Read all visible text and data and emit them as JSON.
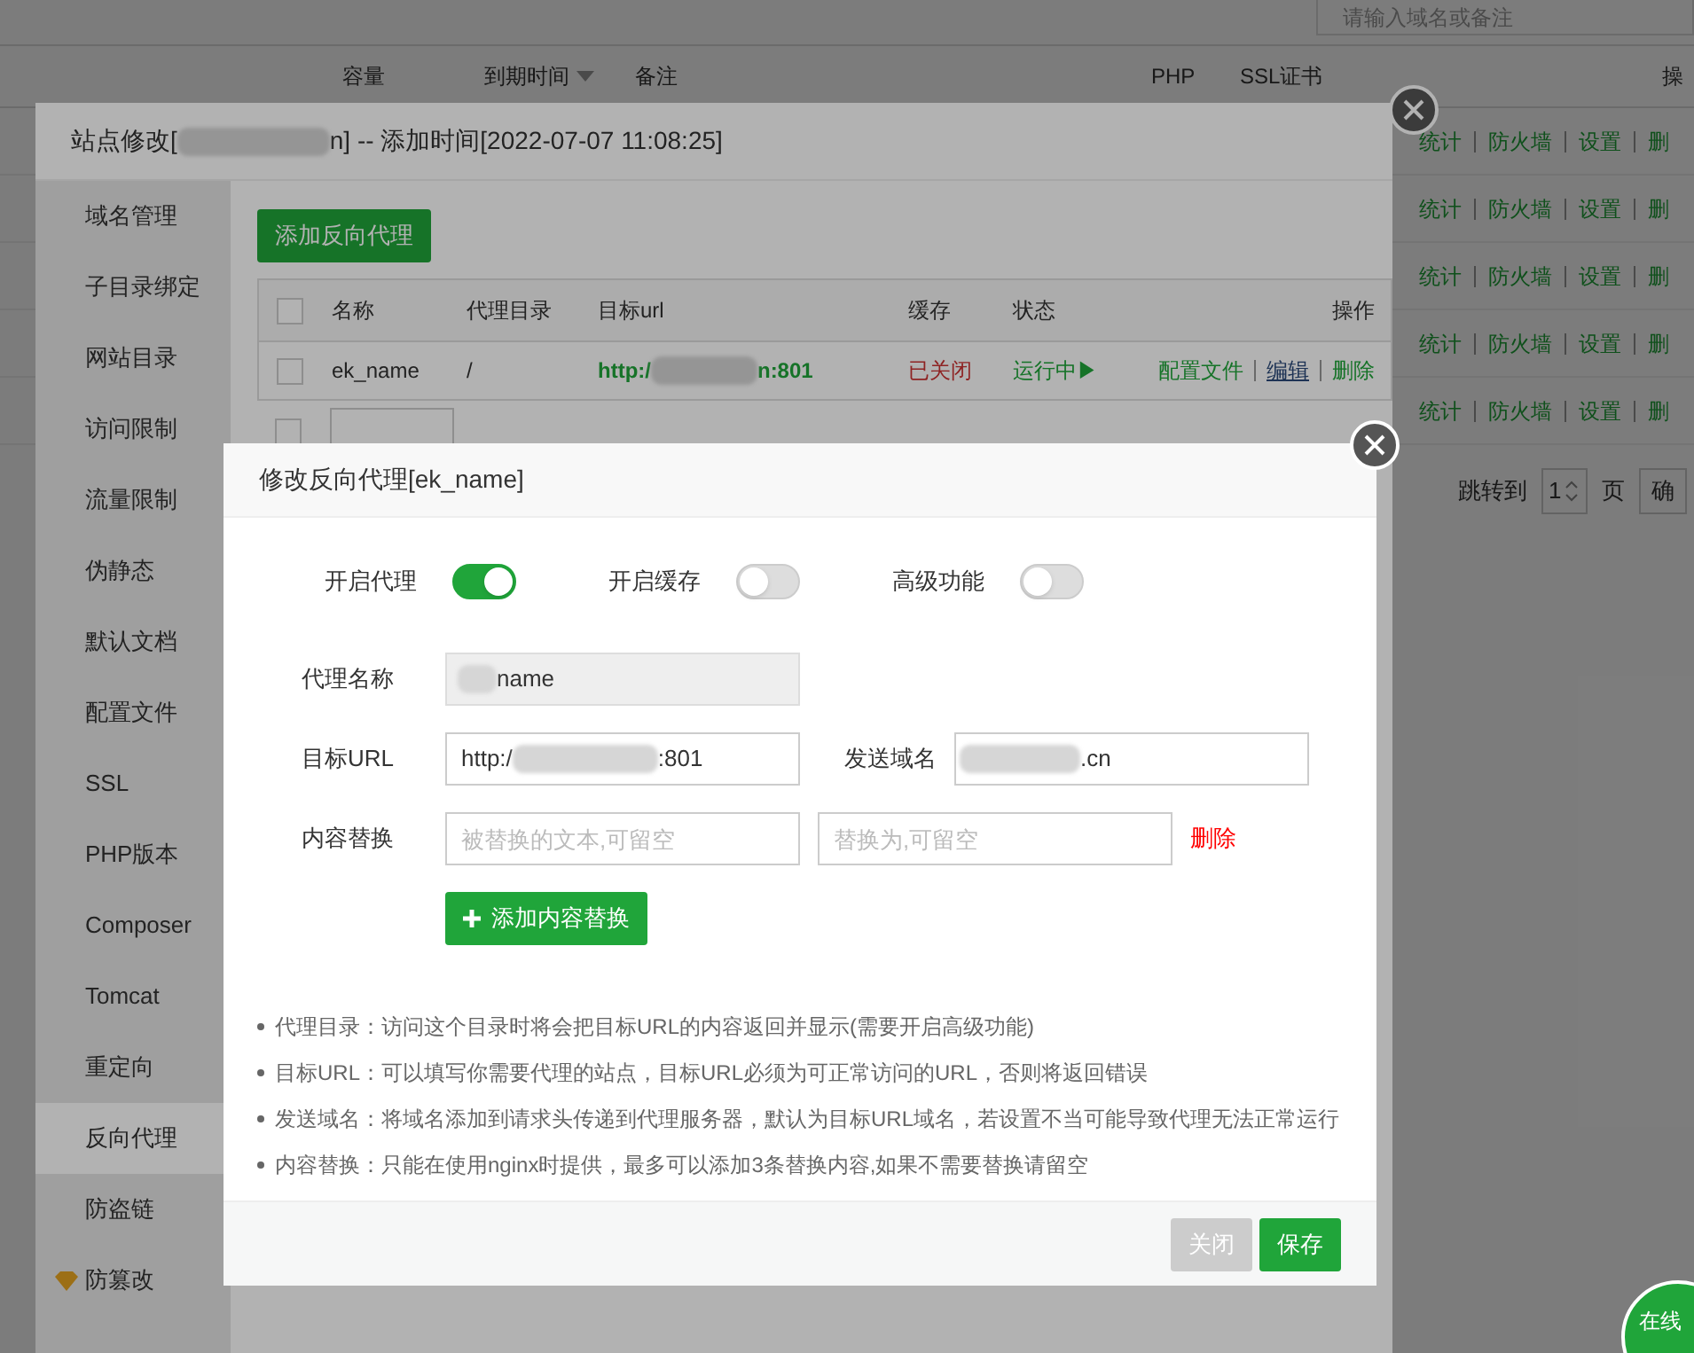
{
  "page": {
    "search": {
      "placeholder": "请输入域名或备注"
    },
    "columns": [
      "容量",
      "到期时间",
      "备注",
      "PHP",
      "SSL证书",
      "操"
    ],
    "rows": [
      {
        "actions": [
          "统计",
          "防火墙",
          "设置",
          "删"
        ]
      },
      {
        "actions": [
          "统计",
          "防火墙",
          "设置",
          "删"
        ]
      },
      {
        "actions": [
          "统计",
          "防火墙",
          "设置",
          "删"
        ]
      },
      {
        "actions": [
          "统计",
          "防火墙",
          "设置",
          "删"
        ]
      },
      {
        "actions": [
          "统计",
          "防火墙",
          "设置",
          "删"
        ]
      }
    ],
    "pagination": {
      "jump_label": "跳转到",
      "page": "1",
      "page_unit": "页",
      "confirm": "确"
    }
  },
  "site_dialog": {
    "title_start": "站点修改[",
    "title_end": "n] -- 添加时间[2022-07-07 11:08:25]",
    "sidebar": [
      {
        "label": "域名管理",
        "selected": false
      },
      {
        "label": "子目录绑定",
        "selected": false
      },
      {
        "label": "网站目录",
        "selected": false
      },
      {
        "label": "访问限制",
        "selected": false
      },
      {
        "label": "流量限制",
        "selected": false
      },
      {
        "label": "伪静态",
        "selected": false
      },
      {
        "label": "默认文档",
        "selected": false
      },
      {
        "label": "配置文件",
        "selected": false
      },
      {
        "label": "SSL",
        "selected": false
      },
      {
        "label": "PHP版本",
        "selected": false
      },
      {
        "label": "Composer",
        "selected": false
      },
      {
        "label": "Tomcat",
        "selected": false
      },
      {
        "label": "重定向",
        "selected": false
      },
      {
        "label": "反向代理",
        "selected": true
      },
      {
        "label": "防盗链",
        "selected": false
      },
      {
        "label": "防篡改",
        "selected": false,
        "premium": true
      }
    ],
    "add_button": "添加反向代理",
    "table": {
      "all_checked": false,
      "columns": [
        "名称",
        "代理目录",
        "目标url",
        "缓存",
        "状态",
        "操作"
      ],
      "rows": [
        {
          "checked": false,
          "name": "ek_name",
          "dir": "/",
          "url_start": "http:/",
          "url_end": "n:801",
          "cache": "已关闭",
          "status": "运行中▶",
          "actions": [
            "配置文件",
            "编辑",
            "删除"
          ]
        }
      ]
    },
    "batch_checked": false
  },
  "proxy_dialog": {
    "title": "修改反向代理[ek_name]",
    "toggles": [
      {
        "label": "开启代理",
        "on": true
      },
      {
        "label": "开启缓存",
        "on": false
      },
      {
        "label": "高级功能",
        "on": false
      }
    ],
    "name_label": "代理名称",
    "name_value_end": "name",
    "url_label": "目标URL",
    "url_start": "http:/",
    "url_end": ":801",
    "host_label": "发送域名",
    "host_end": ".cn",
    "replace_label": "内容替换",
    "replace_from": {
      "placeholder": "被替换的文本,可留空"
    },
    "replace_to": {
      "placeholder": "替换为,可留空"
    },
    "replace_delete": "删除",
    "add_replace": "添加内容替换",
    "notes": [
      "代理目录：访问这个目录时将会把目标URL的内容返回并显示(需要开启高级功能)",
      "目标URL：可以填写你需要代理的站点，目标URL必须为可正常访问的URL，否则将返回错误",
      "发送域名：将域名添加到请求头传递到代理服务器，默认为目标URL域名，若设置不当可能导致代理无法正常运行",
      "内容替换：只能在使用nginx时提供，最多可以添加3条替换内容,如果不需要替换请留空"
    ],
    "buttons": [
      {
        "label": "关闭",
        "kind": "secondary"
      },
      {
        "label": "保存",
        "kind": "primary"
      }
    ]
  },
  "chat_badge": "在线"
}
